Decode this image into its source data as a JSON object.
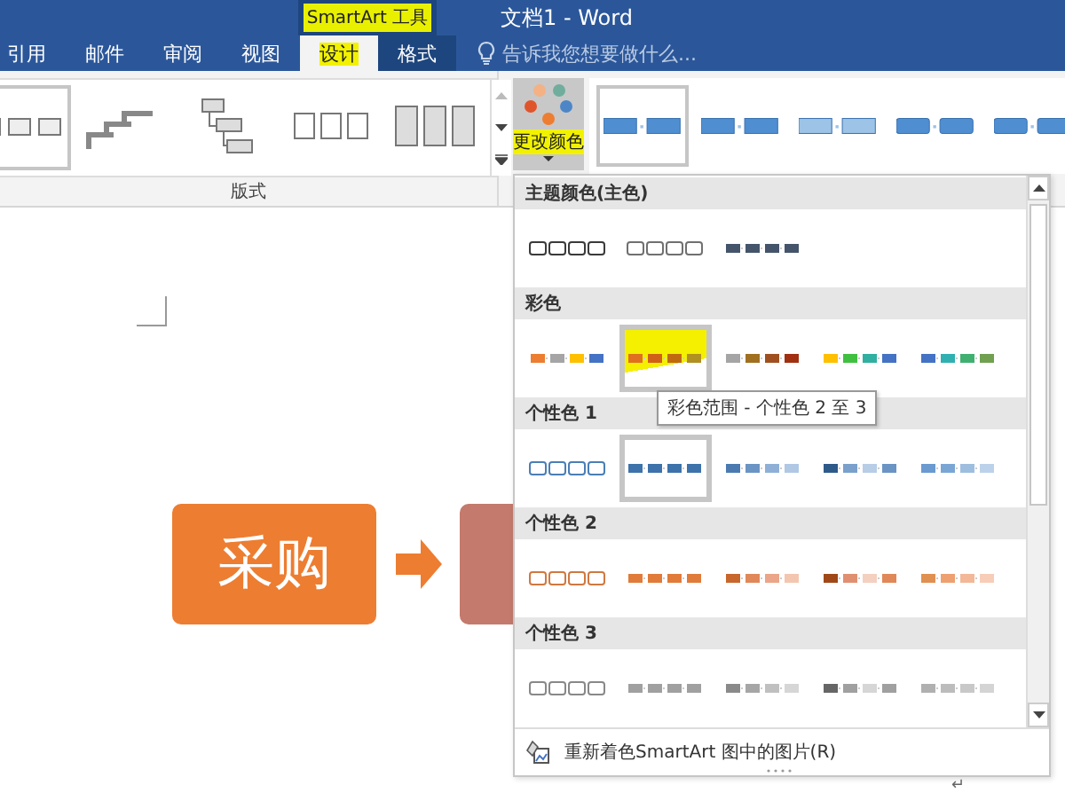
{
  "window": {
    "title": "文档1 - Word",
    "context_group": {
      "label": "SmartArt 工具",
      "highlighted": true
    }
  },
  "tabs": [
    {
      "label": "引用",
      "selected": false,
      "contextual": false,
      "highlighted": false
    },
    {
      "label": "邮件",
      "selected": false,
      "contextual": false,
      "highlighted": false
    },
    {
      "label": "审阅",
      "selected": false,
      "contextual": false,
      "highlighted": false
    },
    {
      "label": "视图",
      "selected": false,
      "contextual": false,
      "highlighted": false
    },
    {
      "label": "设计",
      "selected": true,
      "contextual": true,
      "highlighted": true
    },
    {
      "label": "格式",
      "selected": false,
      "contextual": true,
      "highlighted": false
    }
  ],
  "tell_me": {
    "placeholder": "告诉我您想要做什么..."
  },
  "ribbon": {
    "layouts": {
      "label": "版式",
      "items": [
        {
          "selected": true
        },
        {
          "selected": false
        },
        {
          "selected": false
        },
        {
          "selected": false
        },
        {
          "selected": false
        }
      ]
    },
    "change_colors": {
      "label": "更改颜色",
      "highlighted": true
    },
    "styles": {
      "items": [
        {
          "selected": true
        },
        {
          "selected": false
        },
        {
          "selected": false
        },
        {
          "selected": false
        },
        {
          "selected": false
        }
      ]
    }
  },
  "color_menu": {
    "sections": [
      {
        "title": "主题颜色(主色)",
        "swatches": [
          {
            "kind": "outline",
            "segments": [
              {
                "color": "#3a3a3a"
              },
              {
                "color": "#3a3a3a"
              },
              {
                "color": "#3a3a3a"
              },
              {
                "color": "#3a3a3a"
              }
            ],
            "selected": false,
            "highlighted": false
          },
          {
            "kind": "outline",
            "segments": [
              {
                "color": "#707070"
              },
              {
                "color": "#707070"
              },
              {
                "color": "#707070"
              },
              {
                "color": "#707070"
              }
            ],
            "selected": false,
            "highlighted": false
          },
          {
            "kind": "filled",
            "segments": [
              {
                "color": "#44546a"
              },
              {
                "color": "#44546a"
              },
              {
                "color": "#44546a"
              },
              {
                "color": "#44546a"
              }
            ],
            "selected": false,
            "highlighted": false
          }
        ]
      },
      {
        "title": "彩色",
        "swatches": [
          {
            "kind": "filled",
            "segments": [
              {
                "color": "#ed7d31"
              },
              {
                "color": "#a5a5a5"
              },
              {
                "color": "#ffc000"
              },
              {
                "color": "#4472c4"
              }
            ],
            "selected": false,
            "highlighted": false
          },
          {
            "kind": "filled",
            "segments": [
              {
                "color": "#e07020"
              },
              {
                "color": "#d06018"
              },
              {
                "color": "#c06a10"
              },
              {
                "color": "#b09020"
              }
            ],
            "selected": true,
            "highlighted": true
          },
          {
            "kind": "filled",
            "segments": [
              {
                "color": "#a5a5a5"
              },
              {
                "color": "#a07020"
              },
              {
                "color": "#a05020"
              },
              {
                "color": "#a03010"
              }
            ],
            "selected": false,
            "highlighted": false
          },
          {
            "kind": "filled",
            "segments": [
              {
                "color": "#ffc000"
              },
              {
                "color": "#40c040"
              },
              {
                "color": "#30b0a0"
              },
              {
                "color": "#4472c4"
              }
            ],
            "selected": false,
            "highlighted": false
          },
          {
            "kind": "filled",
            "segments": [
              {
                "color": "#4472c4"
              },
              {
                "color": "#30b0b0"
              },
              {
                "color": "#40b070"
              },
              {
                "color": "#70a050"
              }
            ],
            "selected": false,
            "highlighted": false
          }
        ]
      },
      {
        "title": "个性色 1",
        "swatches": [
          {
            "kind": "outline",
            "segments": [
              {
                "color": "#4a7eb5"
              },
              {
                "color": "#4a7eb5"
              },
              {
                "color": "#4a7eb5"
              },
              {
                "color": "#4a7eb5"
              }
            ],
            "selected": false,
            "highlighted": false
          },
          {
            "kind": "filled",
            "segments": [
              {
                "color": "#3d72aa"
              },
              {
                "color": "#3d72aa"
              },
              {
                "color": "#3d72aa"
              },
              {
                "color": "#3d72aa"
              }
            ],
            "selected": true,
            "highlighted": false
          },
          {
            "kind": "filled",
            "segments": [
              {
                "color": "#4a7ab0"
              },
              {
                "color": "#6a94c4"
              },
              {
                "color": "#8fb0d6"
              },
              {
                "color": "#b0c8e4"
              }
            ],
            "selected": false,
            "highlighted": false
          },
          {
            "kind": "filled",
            "segments": [
              {
                "color": "#2e5a8a"
              },
              {
                "color": "#7aa0cc"
              },
              {
                "color": "#b8cde6"
              },
              {
                "color": "#6a94c4"
              }
            ],
            "selected": false,
            "highlighted": false
          },
          {
            "kind": "filled",
            "segments": [
              {
                "color": "#6a9ad0"
              },
              {
                "color": "#7aa6d6"
              },
              {
                "color": "#9ebedf"
              },
              {
                "color": "#bcd2ea"
              }
            ],
            "selected": false,
            "highlighted": false
          }
        ]
      },
      {
        "title": "个性色 2",
        "swatches": [
          {
            "kind": "outline",
            "segments": [
              {
                "color": "#d07840"
              },
              {
                "color": "#d07840"
              },
              {
                "color": "#d07840"
              },
              {
                "color": "#d07840"
              }
            ],
            "selected": false,
            "highlighted": false
          },
          {
            "kind": "filled",
            "segments": [
              {
                "color": "#e07b39"
              },
              {
                "color": "#e07b39"
              },
              {
                "color": "#e07b39"
              },
              {
                "color": "#e07b39"
              }
            ],
            "selected": false,
            "highlighted": false
          },
          {
            "kind": "filled",
            "segments": [
              {
                "color": "#c8662c"
              },
              {
                "color": "#e08858"
              },
              {
                "color": "#eba588"
              },
              {
                "color": "#f3c6b0"
              }
            ],
            "selected": false,
            "highlighted": false
          },
          {
            "kind": "filled",
            "segments": [
              {
                "color": "#a04818"
              },
              {
                "color": "#e09070"
              },
              {
                "color": "#f4d0c0"
              },
              {
                "color": "#e08858"
              }
            ],
            "selected": false,
            "highlighted": false
          },
          {
            "kind": "filled",
            "segments": [
              {
                "color": "#e09050"
              },
              {
                "color": "#eea070"
              },
              {
                "color": "#f3b898"
              },
              {
                "color": "#f7cdb8"
              }
            ],
            "selected": false,
            "highlighted": false
          }
        ]
      },
      {
        "title": "个性色 3",
        "swatches": [
          {
            "kind": "outline",
            "segments": [
              {
                "color": "#888888"
              },
              {
                "color": "#888888"
              },
              {
                "color": "#888888"
              },
              {
                "color": "#888888"
              }
            ],
            "selected": false,
            "highlighted": false
          },
          {
            "kind": "filled",
            "segments": [
              {
                "color": "#a0a0a0"
              },
              {
                "color": "#a0a0a0"
              },
              {
                "color": "#a0a0a0"
              },
              {
                "color": "#a0a0a0"
              }
            ],
            "selected": false,
            "highlighted": false
          },
          {
            "kind": "filled",
            "segments": [
              {
                "color": "#8a8a8a"
              },
              {
                "color": "#a6a6a6"
              },
              {
                "color": "#c0c0c0"
              },
              {
                "color": "#d6d6d6"
              }
            ],
            "selected": false,
            "highlighted": false
          },
          {
            "kind": "filled",
            "segments": [
              {
                "color": "#666666"
              },
              {
                "color": "#a0a0a0"
              },
              {
                "color": "#d6d6d6"
              },
              {
                "color": "#a0a0a0"
              }
            ],
            "selected": false,
            "highlighted": false
          },
          {
            "kind": "filled",
            "segments": [
              {
                "color": "#b0b0b0"
              },
              {
                "color": "#bcbcbc"
              },
              {
                "color": "#c8c8c8"
              },
              {
                "color": "#d4d4d4"
              }
            ],
            "selected": false,
            "highlighted": false
          }
        ]
      }
    ],
    "tooltip": "彩色范围 - 个性色 2 至 3",
    "footer": "重新着色SmartArt 图中的图片(R)"
  },
  "document": {
    "smartart": [
      {
        "label": "采购",
        "color": "#ed7d31"
      },
      {
        "color": "#c47a6c"
      }
    ],
    "paragraph_mark": "↵"
  }
}
